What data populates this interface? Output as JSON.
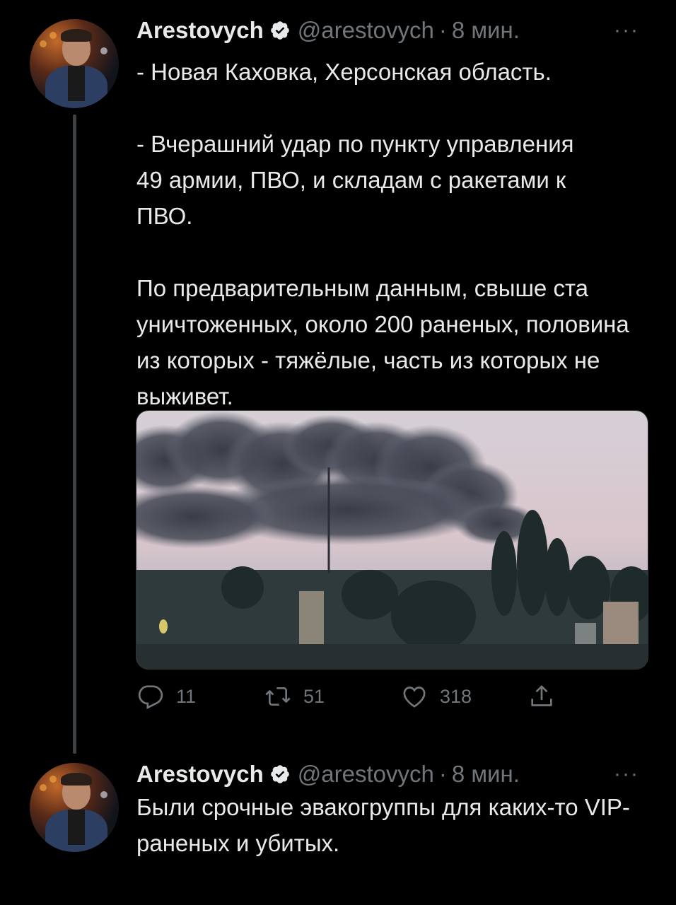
{
  "tweets": [
    {
      "author_name": "Arestovych",
      "handle": "@arestovych",
      "separator": "·",
      "time": "8 мин.",
      "more": "···",
      "paragraphs": [
        "- Новая Каховка, Херсонская область.",
        "- Вчерашний удар по пункту управления 49 армии, ПВО, и складам с ракетами к ПВО.",
        "По предварительным данным, свыше ста уничтоженных, около 200 раненых, половина из которых - тяжёлые, часть из которых не выживет."
      ],
      "actions": {
        "replies": "11",
        "retweets": "51",
        "likes": "318"
      }
    },
    {
      "author_name": "Arestovych",
      "handle": "@arestovych",
      "separator": "·",
      "time": "8 мин.",
      "more": "···",
      "paragraphs": [
        "Были срочные эвакогруппы для каких-то VIP-раненых и убитых."
      ]
    }
  ],
  "colors": {
    "background": "#000000",
    "text": "#e7e9ea",
    "secondary": "#71767b",
    "verified": "#e7e9ea"
  },
  "icons": [
    "verified-icon",
    "reply-icon",
    "retweet-icon",
    "like-icon",
    "share-icon",
    "more-icon"
  ]
}
